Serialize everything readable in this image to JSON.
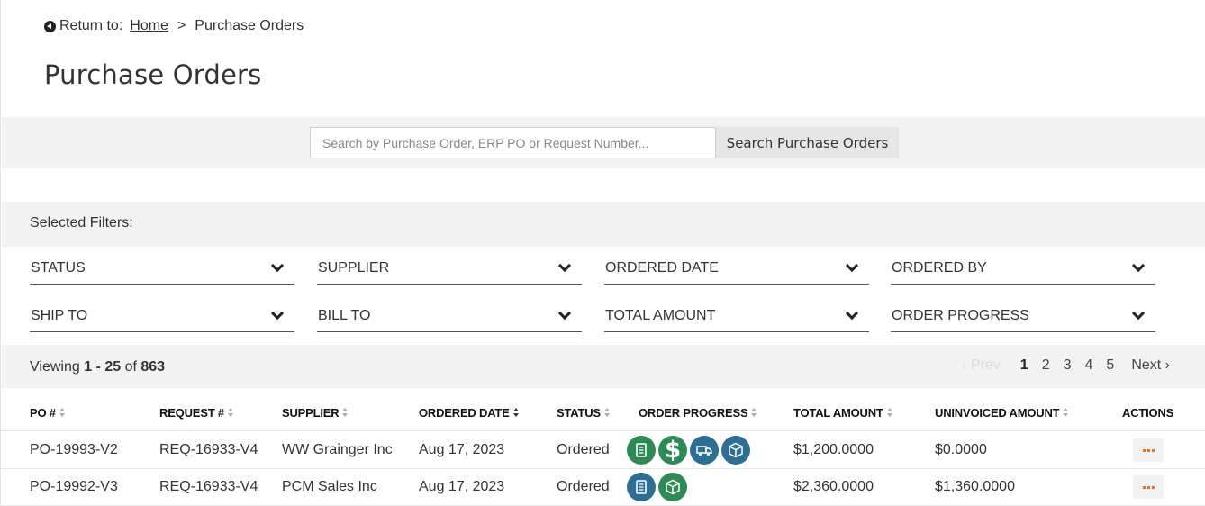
{
  "breadcrumb": {
    "return_label": "Return to:",
    "home_link": "Home",
    "separator": ">",
    "current": "Purchase Orders"
  },
  "page_title": "Purchase Orders",
  "search": {
    "placeholder": "Search by Purchase Order, ERP PO or Request Number...",
    "value": "",
    "button_label": "Search Purchase Orders"
  },
  "filters": {
    "selected_label": "Selected Filters:",
    "dropdowns": [
      "STATUS",
      "SUPPLIER",
      "ORDERED DATE",
      "ORDERED BY",
      "SHIP TO",
      "BILL TO",
      "TOTAL AMOUNT",
      "ORDER PROGRESS"
    ]
  },
  "viewing": {
    "prefix": "Viewing",
    "range": "1 - 25",
    "of": "of",
    "total": "863"
  },
  "pagination": {
    "prev": "‹ Prev",
    "pages": [
      "1",
      "2",
      "3",
      "4",
      "5"
    ],
    "current": "1",
    "next": "Next ›"
  },
  "table": {
    "headers": [
      "PO #",
      "REQUEST #",
      "SUPPLIER",
      "ORDERED DATE",
      "STATUS",
      "ORDER PROGRESS",
      "TOTAL AMOUNT",
      "UNINVOICED AMOUNT",
      "ACTIONS"
    ],
    "rows": [
      {
        "po": "PO-19993-V2",
        "request": "REQ-16933-V4",
        "supplier": "WW Grainger Inc",
        "date": "Aug 17, 2023",
        "status": "Ordered",
        "progress": [
          {
            "icon": "document-icon",
            "color": "#2e8b57"
          },
          {
            "icon": "dollar-icon",
            "color": "#2e8b57"
          },
          {
            "icon": "truck-icon",
            "color": "#2c6e94"
          },
          {
            "icon": "package-icon",
            "color": "#2c6e94"
          }
        ],
        "total": "$1,200.0000",
        "uninvoiced": "$0.0000"
      },
      {
        "po": "PO-19992-V3",
        "request": "REQ-16933-V4",
        "supplier": "PCM Sales Inc",
        "date": "Aug 17, 2023",
        "status": "Ordered",
        "progress": [
          {
            "icon": "document-icon",
            "color": "#2c6e94"
          },
          {
            "icon": "package-icon",
            "color": "#2e8b57"
          }
        ],
        "total": "$2,360.0000",
        "uninvoiced": "$1,360.0000"
      }
    ]
  },
  "icon_glyphs": {
    "dollar": "$"
  },
  "colors": {
    "green": "#2e8b57",
    "blue": "#2c6e94",
    "actions_dots": "#e8731a",
    "band_bg": "#f2f2f2"
  }
}
